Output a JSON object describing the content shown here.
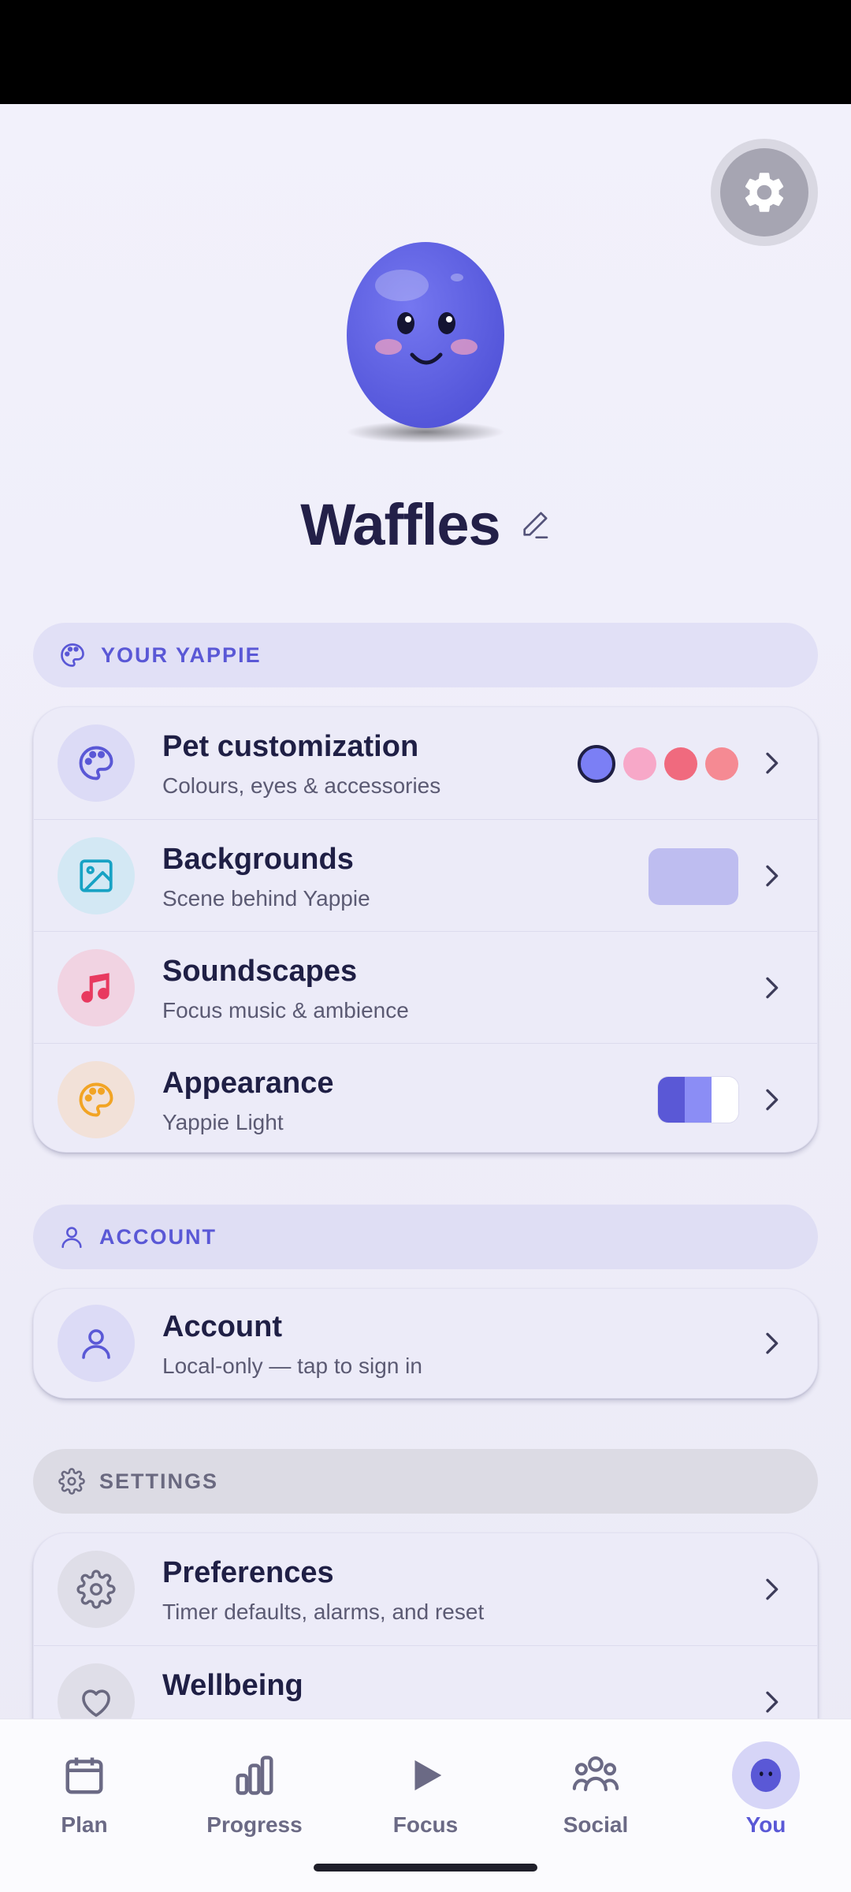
{
  "pet": {
    "name": "Waffles"
  },
  "sections": {
    "your_yappie": "YOUR YAPPIE",
    "account": "ACCOUNT",
    "settings": "SETTINGS"
  },
  "yappie_rows": [
    {
      "title": "Pet customization",
      "subtitle": "Colours, eyes & accessories",
      "icon": "palette-icon"
    },
    {
      "title": "Backgrounds",
      "subtitle": "Scene behind Yappie",
      "icon": "image-icon"
    },
    {
      "title": "Soundscapes",
      "subtitle": "Focus music & ambience",
      "icon": "music-note-icon"
    },
    {
      "title": "Appearance",
      "subtitle": "Yappie Light",
      "icon": "palette-icon"
    }
  ],
  "account_row": {
    "title": "Account",
    "subtitle": "Local-only — tap to sign in",
    "icon": "person-icon"
  },
  "settings_rows": [
    {
      "title": "Preferences",
      "subtitle": "Timer defaults, alarms, and reset",
      "icon": "gear-icon"
    },
    {
      "title": "Wellbeing",
      "subtitle": "",
      "icon": "heart-icon"
    }
  ],
  "swatch_colors": [
    "#7b7ff5",
    "#f7a8c8",
    "#f06a7e",
    "#f58a93"
  ],
  "bottom_nav": [
    {
      "label": "Plan",
      "icon": "calendar-icon",
      "active": false
    },
    {
      "label": "Progress",
      "icon": "bar-chart-icon",
      "active": false
    },
    {
      "label": "Focus",
      "icon": "play-icon",
      "active": false
    },
    {
      "label": "Social",
      "icon": "people-icon",
      "active": false
    },
    {
      "label": "You",
      "icon": "yappie-avatar-icon",
      "active": true
    }
  ],
  "colors": {
    "accent": "#5a58d6",
    "pet_body": "#6466e6",
    "background": "#f0eff9"
  }
}
